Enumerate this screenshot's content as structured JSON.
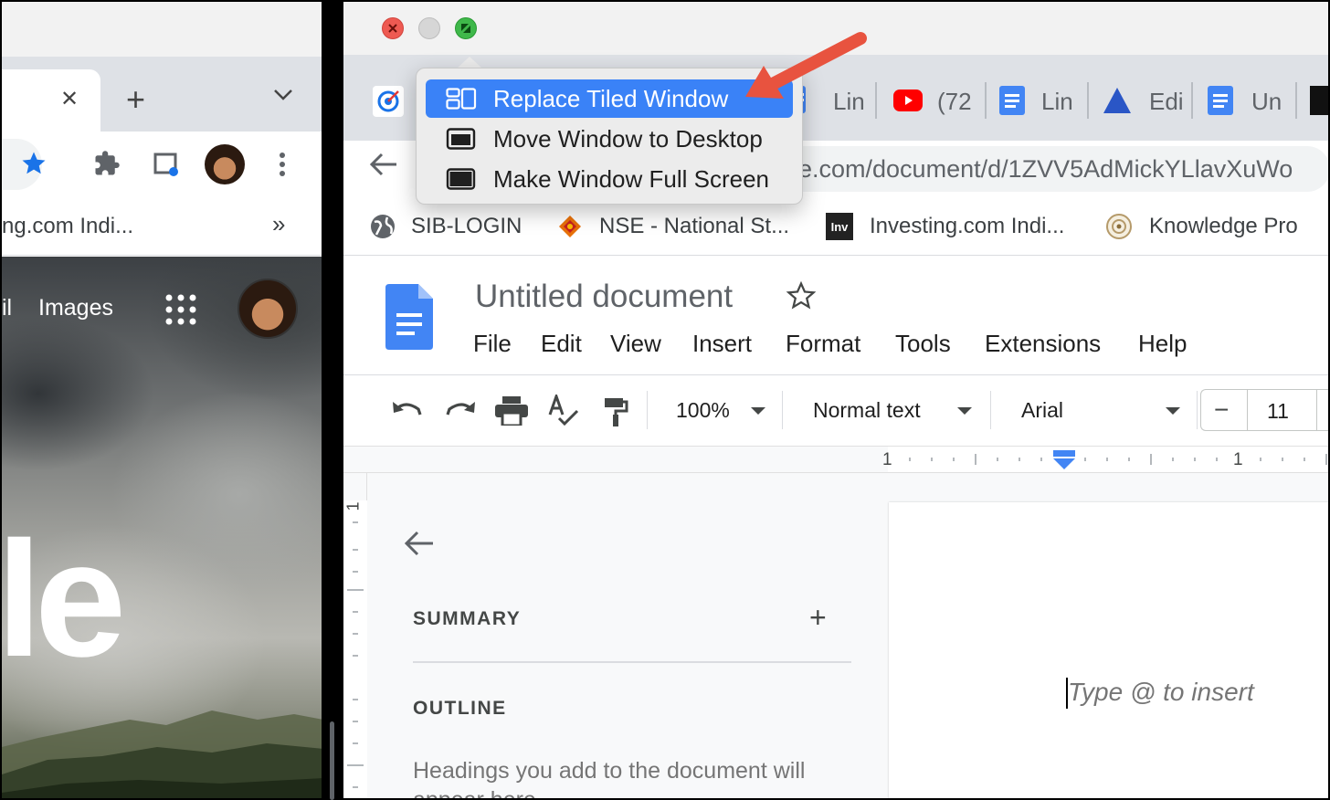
{
  "popup_menu": {
    "items": [
      {
        "label": "Replace Tiled Window",
        "selected": true,
        "icon": "tiled-window-icon"
      },
      {
        "label": "Move Window to Desktop",
        "selected": false,
        "icon": "window-icon"
      },
      {
        "label": "Make Window Full Screen",
        "selected": false,
        "icon": "fullscreen-window-icon"
      }
    ]
  },
  "left_window": {
    "bookmark_truncated": "ng.com Indi...",
    "more_bookmarks": "»",
    "new_tab": "+",
    "close_tab": "✕",
    "google_links": {
      "partial": "il",
      "images": "Images"
    },
    "logo_fragment": "le"
  },
  "right_window": {
    "tabs": [
      {
        "label": "Lin",
        "icon": "docs-icon"
      },
      {
        "label": "(72",
        "icon": "youtube-icon"
      },
      {
        "label": "Lin",
        "icon": "docs-icon"
      },
      {
        "label": "Edi",
        "icon": "triangle-icon"
      },
      {
        "label": "Un",
        "icon": "docs-icon"
      }
    ],
    "url_visible": "e.com/document/d/1ZVV5AdMickYLlavXuWo",
    "bookmarks": [
      {
        "label": "SIB-LOGIN",
        "icon": "globe-icon"
      },
      {
        "label": "NSE - National St...",
        "icon": "nse-icon"
      },
      {
        "label": "Investing.com Indi...",
        "icon": "investing-icon",
        "icon_text": "Inv"
      },
      {
        "label": "Knowledge Pro",
        "icon": "seal-icon"
      }
    ],
    "doc_title": "Untitled document",
    "menus": [
      "File",
      "Edit",
      "View",
      "Insert",
      "Format",
      "Tools",
      "Extensions",
      "Help"
    ],
    "toolbar": {
      "zoom": "100%",
      "style": "Normal text",
      "font": "Arial",
      "font_size": "11",
      "minus": "−"
    },
    "ruler": {
      "left_num": "1",
      "right_num": "1",
      "v_num": "1"
    },
    "outline_panel": {
      "summary": "SUMMARY",
      "add": "+",
      "outline": "OUTLINE",
      "hint": "Headings you add to the document will",
      "hint_cont": "appear here."
    },
    "doc_placeholder": "Type @ to insert"
  },
  "colors": {
    "selected_menu": "#3a82f7",
    "arrow": "#e8533f",
    "docs_blue": "#4285f4",
    "close_red": "#ee5a52",
    "zoom_green": "#3fb84a"
  }
}
